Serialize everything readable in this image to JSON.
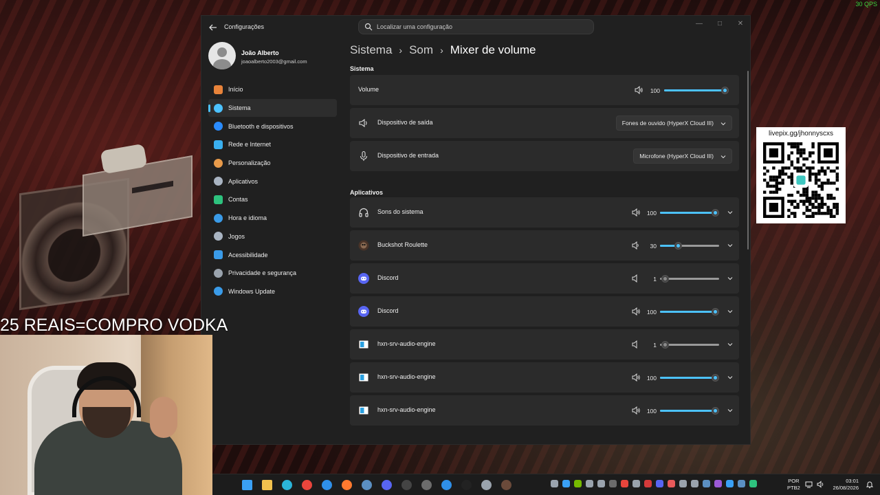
{
  "overlay": {
    "fps": "30 QPS",
    "donation_text": "25 REAIS=COMPRO VODKA",
    "qr_caption": "livepix.gg/jhonnyscxs"
  },
  "window": {
    "title": "Configurações",
    "search_placeholder": "Localizar uma configuração",
    "profile": {
      "name": "João Alberto",
      "email": "joaoalberto2003@gmail.com"
    },
    "nav": [
      {
        "label": "Início",
        "icon": "home-icon",
        "color": "#e8833a"
      },
      {
        "label": "Sistema",
        "icon": "system-icon",
        "color": "#4cc2ff",
        "active": true
      },
      {
        "label": "Bluetooth e dispositivos",
        "icon": "bluetooth-icon",
        "color": "#2a8cff"
      },
      {
        "label": "Rede e Internet",
        "icon": "wifi-icon",
        "color": "#3ab0f0"
      },
      {
        "label": "Personalização",
        "icon": "brush-icon",
        "color": "#e89a4a"
      },
      {
        "label": "Aplicativos",
        "icon": "apps-icon",
        "color": "#a9b4c2"
      },
      {
        "label": "Contas",
        "icon": "accounts-icon",
        "color": "#2ec27e"
      },
      {
        "label": "Hora e idioma",
        "icon": "clock-globe-icon",
        "color": "#3a9be8"
      },
      {
        "label": "Jogos",
        "icon": "gamepad-icon",
        "color": "#a9b4c2"
      },
      {
        "label": "Acessibilidade",
        "icon": "accessibility-icon",
        "color": "#3a9be8"
      },
      {
        "label": "Privacidade e segurança",
        "icon": "shield-icon",
        "color": "#9aa3ad"
      },
      {
        "label": "Windows Update",
        "icon": "windows-update-icon",
        "color": "#3a9be8"
      }
    ],
    "breadcrumb": [
      "Sistema",
      "Som",
      "Mixer de volume"
    ],
    "sistema": {
      "heading": "Sistema",
      "volume_label": "Volume",
      "volume_value": "100",
      "volume_level": 100,
      "output_label": "Dispositivo de saída",
      "output_value": "Fones de ouvido (HyperX Cloud III)",
      "input_label": "Dispositivo de entrada",
      "input_value": "Microfone (HyperX Cloud III)"
    },
    "apps_heading": "Aplicativos",
    "apps": [
      {
        "name": "Sons do sistema",
        "value": "100",
        "level": 100,
        "icon": "headphones-icon"
      },
      {
        "name": "Buckshot Roulette",
        "value": "30",
        "level": 30,
        "icon": "buckshot-roulette-icon"
      },
      {
        "name": "Discord",
        "value": "1",
        "level": 1,
        "icon": "discord-icon"
      },
      {
        "name": "Discord",
        "value": "100",
        "level": 100,
        "icon": "discord-icon"
      },
      {
        "name": "hxn-srv-audio-engine",
        "value": "1",
        "level": 1,
        "icon": "app-window-icon"
      },
      {
        "name": "hxn-srv-audio-engine",
        "value": "100",
        "level": 100,
        "icon": "app-window-icon"
      },
      {
        "name": "hxn-srv-audio-engine",
        "value": "100",
        "level": 100,
        "icon": "app-window-icon"
      }
    ]
  },
  "taskbar": {
    "apps": [
      {
        "icon": "windows-start-icon",
        "color": "#3aa0f5"
      },
      {
        "icon": "file-explorer-icon",
        "color": "#f2c14e"
      },
      {
        "icon": "edge-icon",
        "color": "#2bb4d9"
      },
      {
        "icon": "chrome-icon",
        "color": "#e8453c"
      },
      {
        "icon": "battlenet-icon",
        "color": "#2f8fe8"
      },
      {
        "icon": "firefox-icon",
        "color": "#ff7a2f"
      },
      {
        "icon": "steam-icon",
        "color": "#5b8fc2"
      },
      {
        "icon": "discord-icon",
        "color": "#5865f2"
      },
      {
        "icon": "obs-icon",
        "color": "#444444"
      },
      {
        "icon": "nvidia-icon",
        "color": "#6c6c6c"
      },
      {
        "icon": "battlenet-2-icon",
        "color": "#2f8fe8"
      },
      {
        "icon": "lens-icon",
        "color": "#222222"
      },
      {
        "icon": "settings-icon",
        "color": "#9aa3ad"
      },
      {
        "icon": "buckshot-roulette-icon",
        "color": "#6a4a3a"
      }
    ],
    "tray": [
      "#9aa3ad",
      "#3aa0f5",
      "#76b900",
      "#9aa3ad",
      "#9aa3ad",
      "#6c6c6c",
      "#e8453c",
      "#9aa3ad",
      "#d43a3a",
      "#5865f2",
      "#e85a5a",
      "#9aa3ad",
      "#9aa3ad",
      "#5b8fc2",
      "#9b59d6",
      "#3aa0f5",
      "#5b8fc2",
      "#2ec27e"
    ],
    "lang_top": "POR",
    "lang_bottom": "PTB2",
    "time": "03:01",
    "date": "26/08/2026"
  }
}
